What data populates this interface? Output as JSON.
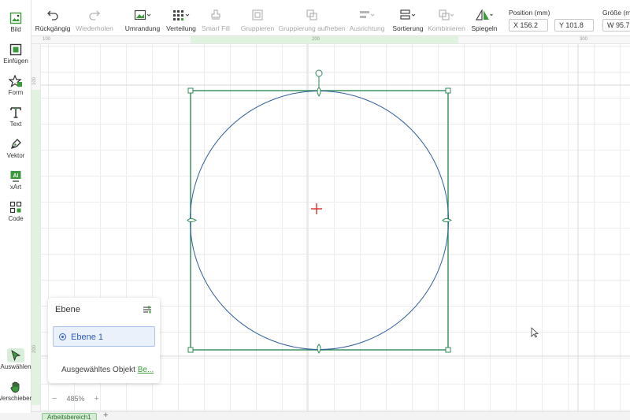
{
  "toolbar": {
    "undo": "Rückgängig",
    "redo": "Wiederholen",
    "outline": "Umrandung",
    "distribute": "Verteilung",
    "smart_fill": "Smart Fill",
    "group": "Gruppieren",
    "ungroup": "Gruppierung aufheben",
    "align": "Ausrichtung",
    "arrange": "Sortierung",
    "combine": "Kombinieren",
    "mirror": "Spiegeln",
    "position_label": "Position (mm)",
    "x_value": "X 156.2",
    "y_value": "Y 101.8",
    "size_label": "Größe (mm)",
    "w_value": "W 95.7"
  },
  "sidebar": {
    "items": [
      {
        "label": "Bild",
        "icon": "image-icon"
      },
      {
        "label": "Einfügen",
        "icon": "insert-icon"
      },
      {
        "label": "Form",
        "icon": "shape-star-icon"
      },
      {
        "label": "Text",
        "icon": "text-icon"
      },
      {
        "label": "Vektor",
        "icon": "pen-icon"
      },
      {
        "label": "xArt",
        "icon": "ai-art-icon"
      },
      {
        "label": "Code",
        "icon": "qr-code-icon"
      }
    ],
    "select": "Auswählen",
    "move": "Verschieben"
  },
  "ruler": {
    "top_ticks": [
      "100",
      "200",
      "300"
    ],
    "left_ticks": [
      "100",
      "200"
    ]
  },
  "layer_panel": {
    "title": "Ebene",
    "layer_name": "Ebene 1",
    "footer_text": "Ausgewähltes Objekt ",
    "footer_link": "Be..."
  },
  "zoom": {
    "minus": "−",
    "value": "485%",
    "plus": "+"
  },
  "tabs": {
    "artboard": "Arbeitsbereich1",
    "add": "+"
  },
  "colors": {
    "accent": "#3a9b3a",
    "selection": "#2e8b57",
    "circle": "#2f5f9f",
    "center_mark": "#e02020"
  }
}
